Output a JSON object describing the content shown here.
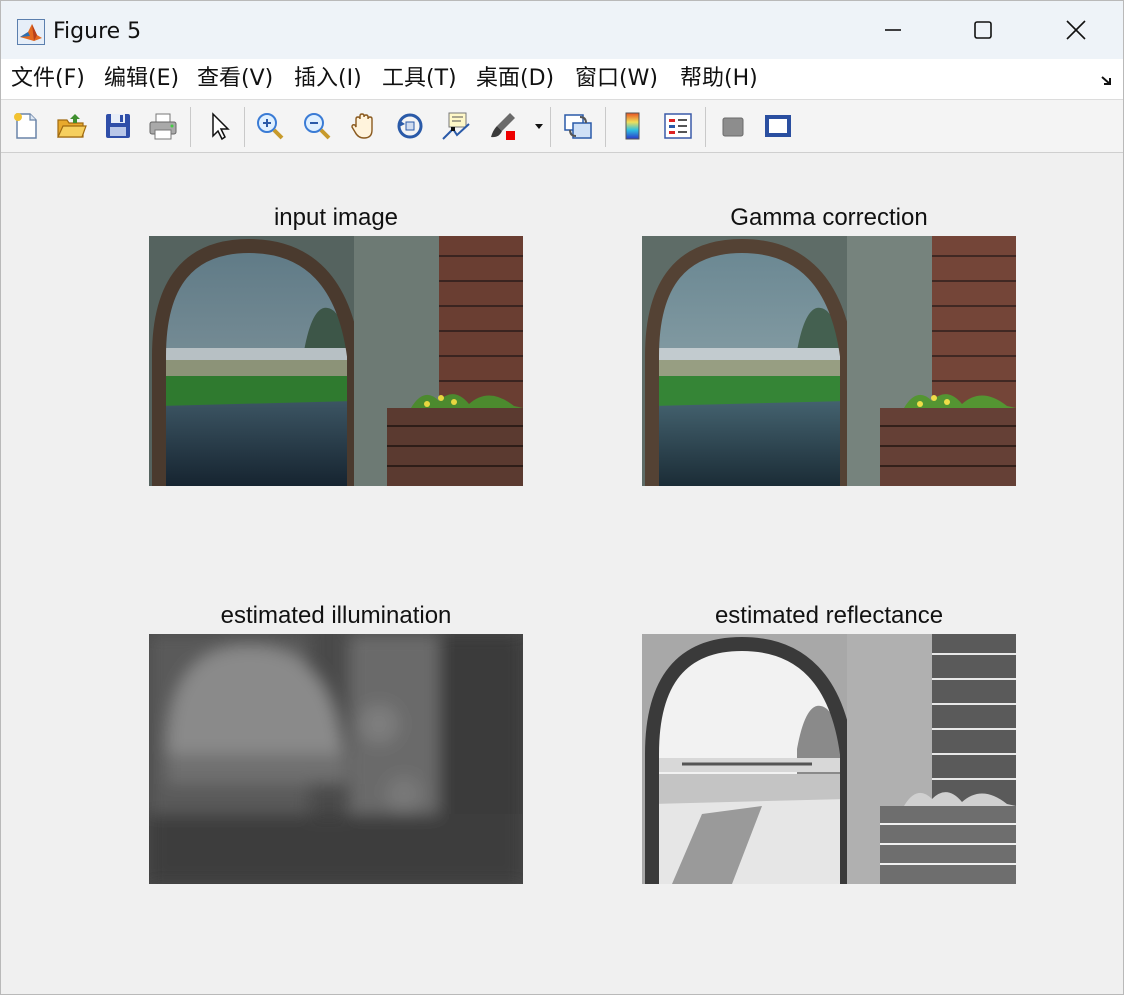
{
  "window": {
    "title": "Figure 5"
  },
  "menu": [
    {
      "label": "文件(F)"
    },
    {
      "label": "编辑(E)"
    },
    {
      "label": "查看(V)"
    },
    {
      "label": "插入(I)"
    },
    {
      "label": "工具(T)"
    },
    {
      "label": "桌面(D)"
    },
    {
      "label": "窗口(W)"
    },
    {
      "label": "帮助(H)"
    }
  ],
  "toolbar_icons": [
    "new-figure-icon",
    "open-file-icon",
    "save-icon",
    "print-icon",
    "select-pointer-icon",
    "zoom-in-icon",
    "zoom-out-icon",
    "pan-hand-icon",
    "rotate-3d-icon",
    "data-cursor-icon",
    "brush-icon",
    "brush-dropdown-icon",
    "link-plot-icon",
    "colorbar-icon",
    "legend-icon",
    "hide-plot-tools-icon",
    "show-plot-tools-icon"
  ],
  "plots": [
    {
      "title": "input image",
      "style": "color"
    },
    {
      "title": "Gamma correction",
      "style": "color"
    },
    {
      "title": "estimated illumination",
      "style": "illum"
    },
    {
      "title": "estimated reflectance",
      "style": "reflect"
    }
  ]
}
